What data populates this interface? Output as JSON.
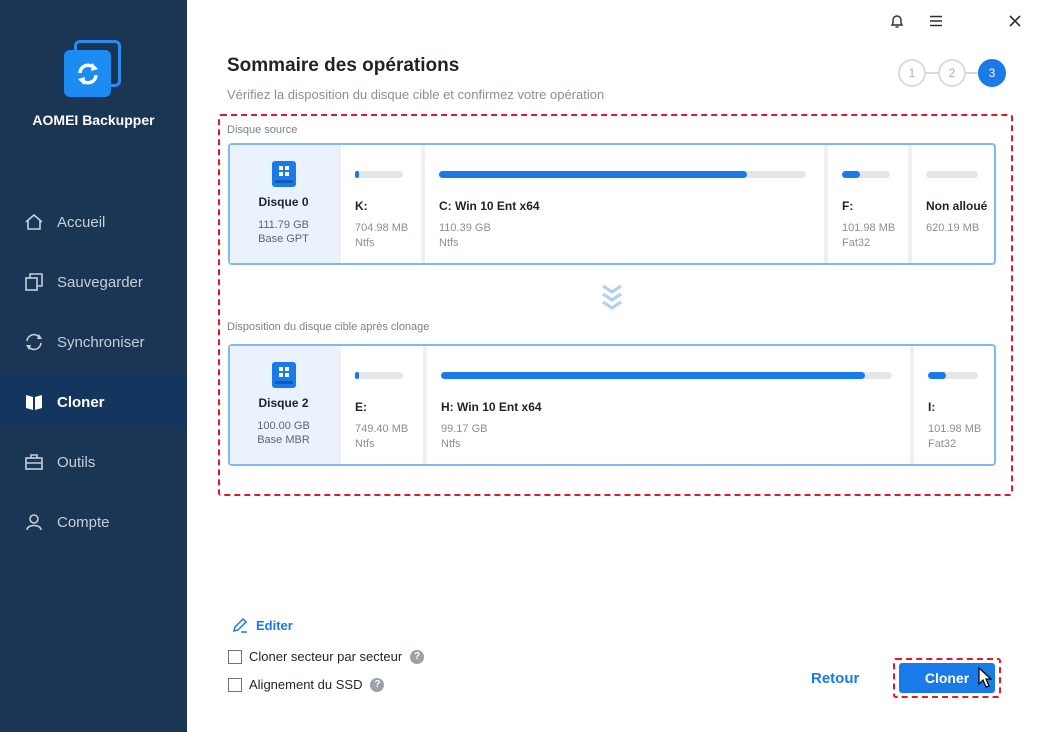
{
  "app": {
    "name": "AOMEI Backupper"
  },
  "sidebar": {
    "items": [
      {
        "label": "Accueil",
        "icon": "home-icon"
      },
      {
        "label": "Sauvegarder",
        "icon": "backup-icon"
      },
      {
        "label": "Synchroniser",
        "icon": "sync-icon"
      },
      {
        "label": "Cloner",
        "icon": "clone-icon",
        "active": true
      },
      {
        "label": "Outils",
        "icon": "tools-icon"
      },
      {
        "label": "Compte",
        "icon": "account-icon"
      }
    ]
  },
  "header": {
    "title": "Sommaire des opérations",
    "subtitle": "Vérifiez la disposition du disque cible et confirmez votre opération",
    "steps": [
      "1",
      "2",
      "3"
    ],
    "active_step": 3
  },
  "source": {
    "label": "Disque source",
    "disk": {
      "name": "Disque 0",
      "size": "111.79 GB",
      "type": "Base GPT"
    },
    "partitions": [
      {
        "name": "K:",
        "size": "704.98 MB",
        "fs": "Ntfs",
        "used": 0.05
      },
      {
        "name": "C: Win 10 Ent x64",
        "size": "110.39 GB",
        "fs": "Ntfs",
        "used": 0.84
      },
      {
        "name": "F:",
        "size": "101.98 MB",
        "fs": "Fat32",
        "used": 0.38
      },
      {
        "name": "Non alloué",
        "size": "620.19 MB",
        "fs": "",
        "used": 0
      }
    ]
  },
  "target": {
    "label": "Disposition du disque cible après clonage",
    "disk": {
      "name": "Disque 2",
      "size": "100.00 GB",
      "type": "Base MBR"
    },
    "partitions": [
      {
        "name": "E:",
        "size": "749.40 MB",
        "fs": "Ntfs",
        "used": 0.05
      },
      {
        "name": "H: Win 10 Ent x64",
        "size": "99.17 GB",
        "fs": "Ntfs",
        "used": 0.94
      },
      {
        "name": "I:",
        "size": "101.98 MB",
        "fs": "Fat32",
        "used": 0.36
      }
    ]
  },
  "footer": {
    "edit_label": "Editer",
    "option_sector": "Cloner secteur par secteur",
    "option_ssd": "Alignement du SSD",
    "help_glyph": "?",
    "back_label": "Retour",
    "clone_label": "Cloner"
  },
  "colors": {
    "accent": "#1a7be8",
    "sidebar": "#1b3554",
    "highlight": "#e0182d"
  }
}
